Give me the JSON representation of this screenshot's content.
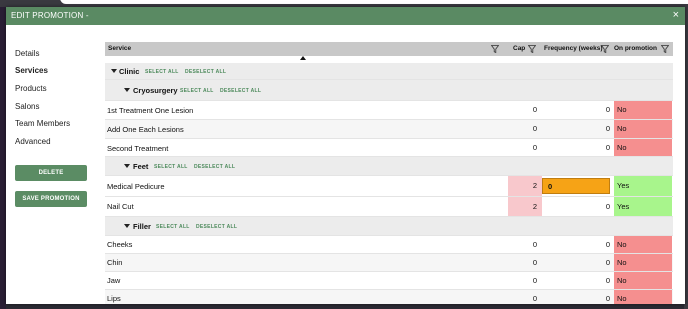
{
  "dialog": {
    "title": "EDIT PROMOTION -",
    "close_symbol": "×"
  },
  "sidebar": {
    "items": [
      {
        "label": "Details",
        "active": false
      },
      {
        "label": "Services",
        "active": true
      },
      {
        "label": "Products",
        "active": false
      },
      {
        "label": "Salons",
        "active": false
      },
      {
        "label": "Team Members",
        "active": false
      },
      {
        "label": "Advanced",
        "active": false
      }
    ],
    "delete_label": "DELETE",
    "save_label": "SAVE PROMOTION"
  },
  "table": {
    "columns": {
      "service": "Service",
      "cap": "Cap",
      "frequency": "Frequency (weeks)",
      "on_promotion": "On promotion"
    },
    "select_all": "SELECT ALL",
    "deselect_all": "DESELECT ALL",
    "groups": [
      {
        "name": "Clinic"
      },
      {
        "name": "Cryosurgery"
      },
      {
        "name": "Feet"
      },
      {
        "name": "Filler"
      }
    ],
    "rows": [
      {
        "name": "1st Treatment One Lesion",
        "cap": "0",
        "freq": "0",
        "promo": "No"
      },
      {
        "name": "Add One Each Lesions",
        "cap": "0",
        "freq": "0",
        "promo": "No"
      },
      {
        "name": "Second Treatment",
        "cap": "0",
        "freq": "0",
        "promo": "No"
      },
      {
        "name": "Medical Pedicure",
        "cap": "2",
        "freq": "0",
        "promo": "Yes"
      },
      {
        "name": "Nail Cut",
        "cap": "2",
        "freq": "0",
        "promo": "Yes"
      },
      {
        "name": "Cheeks",
        "cap": "0",
        "freq": "0",
        "promo": "No"
      },
      {
        "name": "Chin",
        "cap": "0",
        "freq": "0",
        "promo": "No"
      },
      {
        "name": "Jaw",
        "cap": "0",
        "freq": "0",
        "promo": "No"
      },
      {
        "name": "Lips",
        "cap": "0",
        "freq": "0",
        "promo": "No"
      }
    ]
  },
  "colors": {
    "header": "#5a8a63",
    "button": "#5b8c64",
    "no": "#f58f8f",
    "yes": "#a8f58c",
    "cap_highlight": "#f8c8cc",
    "editing": "#f6a316"
  }
}
